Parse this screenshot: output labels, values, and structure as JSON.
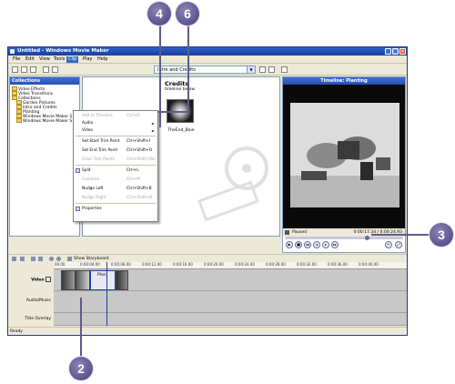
{
  "window": {
    "title": "Untitled - Windows Movie Maker",
    "controls": [
      "_",
      "□",
      "×"
    ]
  },
  "menubar": [
    "File",
    "Edit",
    "View",
    "Tools",
    "Clip",
    "Play",
    "Help"
  ],
  "toolbar": {
    "collection_selected": "Intro and Credits"
  },
  "collections": {
    "header": "Collections",
    "items": [
      "Video Effects",
      "Video Transitions",
      "Collections",
      "Garden Pictures",
      "Intro and Credits",
      "Planting",
      "Windows Movie Maker S",
      "Windows Movie Maker S"
    ]
  },
  "content": {
    "title": "Credits",
    "subtitle": "timeline below",
    "thumb_label": "TheEnd_Blue"
  },
  "clip_menu": {
    "items": [
      {
        "label": "Add to Timeline",
        "shortcut": "Ctrl+D",
        "disabled": true
      },
      {
        "label": "Audio",
        "submenu": true
      },
      {
        "label": "Video",
        "submenu": true
      },
      {
        "label": "Set Start Trim Point",
        "shortcut": "Ctrl+Shift+I"
      },
      {
        "label": "Set End Trim Point",
        "shortcut": "Ctrl+Shift+O"
      },
      {
        "label": "Clear Trim Points",
        "shortcut": "Ctrl+Shift+Del",
        "disabled": true
      },
      {
        "label": "Split",
        "shortcut": "Ctrl+L"
      },
      {
        "label": "Combine",
        "shortcut": "Ctrl+M",
        "disabled": true
      },
      {
        "label": "Nudge Left",
        "shortcut": "Ctrl+Shift+B"
      },
      {
        "label": "Nudge Right",
        "shortcut": "Ctrl+Shift+N",
        "disabled": true
      },
      {
        "label": "Properties"
      }
    ]
  },
  "preview": {
    "title": "Timeline: Planting",
    "status": "Paused",
    "time": "0:00:17.34 / 0:00:24.93",
    "buttons": [
      "▶",
      "■",
      "◂◂",
      "◂",
      "▸",
      "▸▸",
      "✂",
      "⤢"
    ],
    "seek_fraction": 0.7
  },
  "timeline": {
    "show_storyboard": "Show Storyboard",
    "ruler": [
      "00.00",
      "0:00:04.00",
      "0:00:08.00",
      "0:00:12.00",
      "0:00:16.00",
      "0:00:20.00",
      "0:00:24.00",
      "0:00:28.00",
      "0:00:32.00",
      "0:00:36.00",
      "0:00:40.00"
    ],
    "tracks": [
      "Video",
      "Audio/Music",
      "Title Overlay"
    ],
    "clip_label": "Plan"
  },
  "statusbar": "Ready",
  "callouts": [
    "4",
    "6",
    "3",
    "2"
  ]
}
